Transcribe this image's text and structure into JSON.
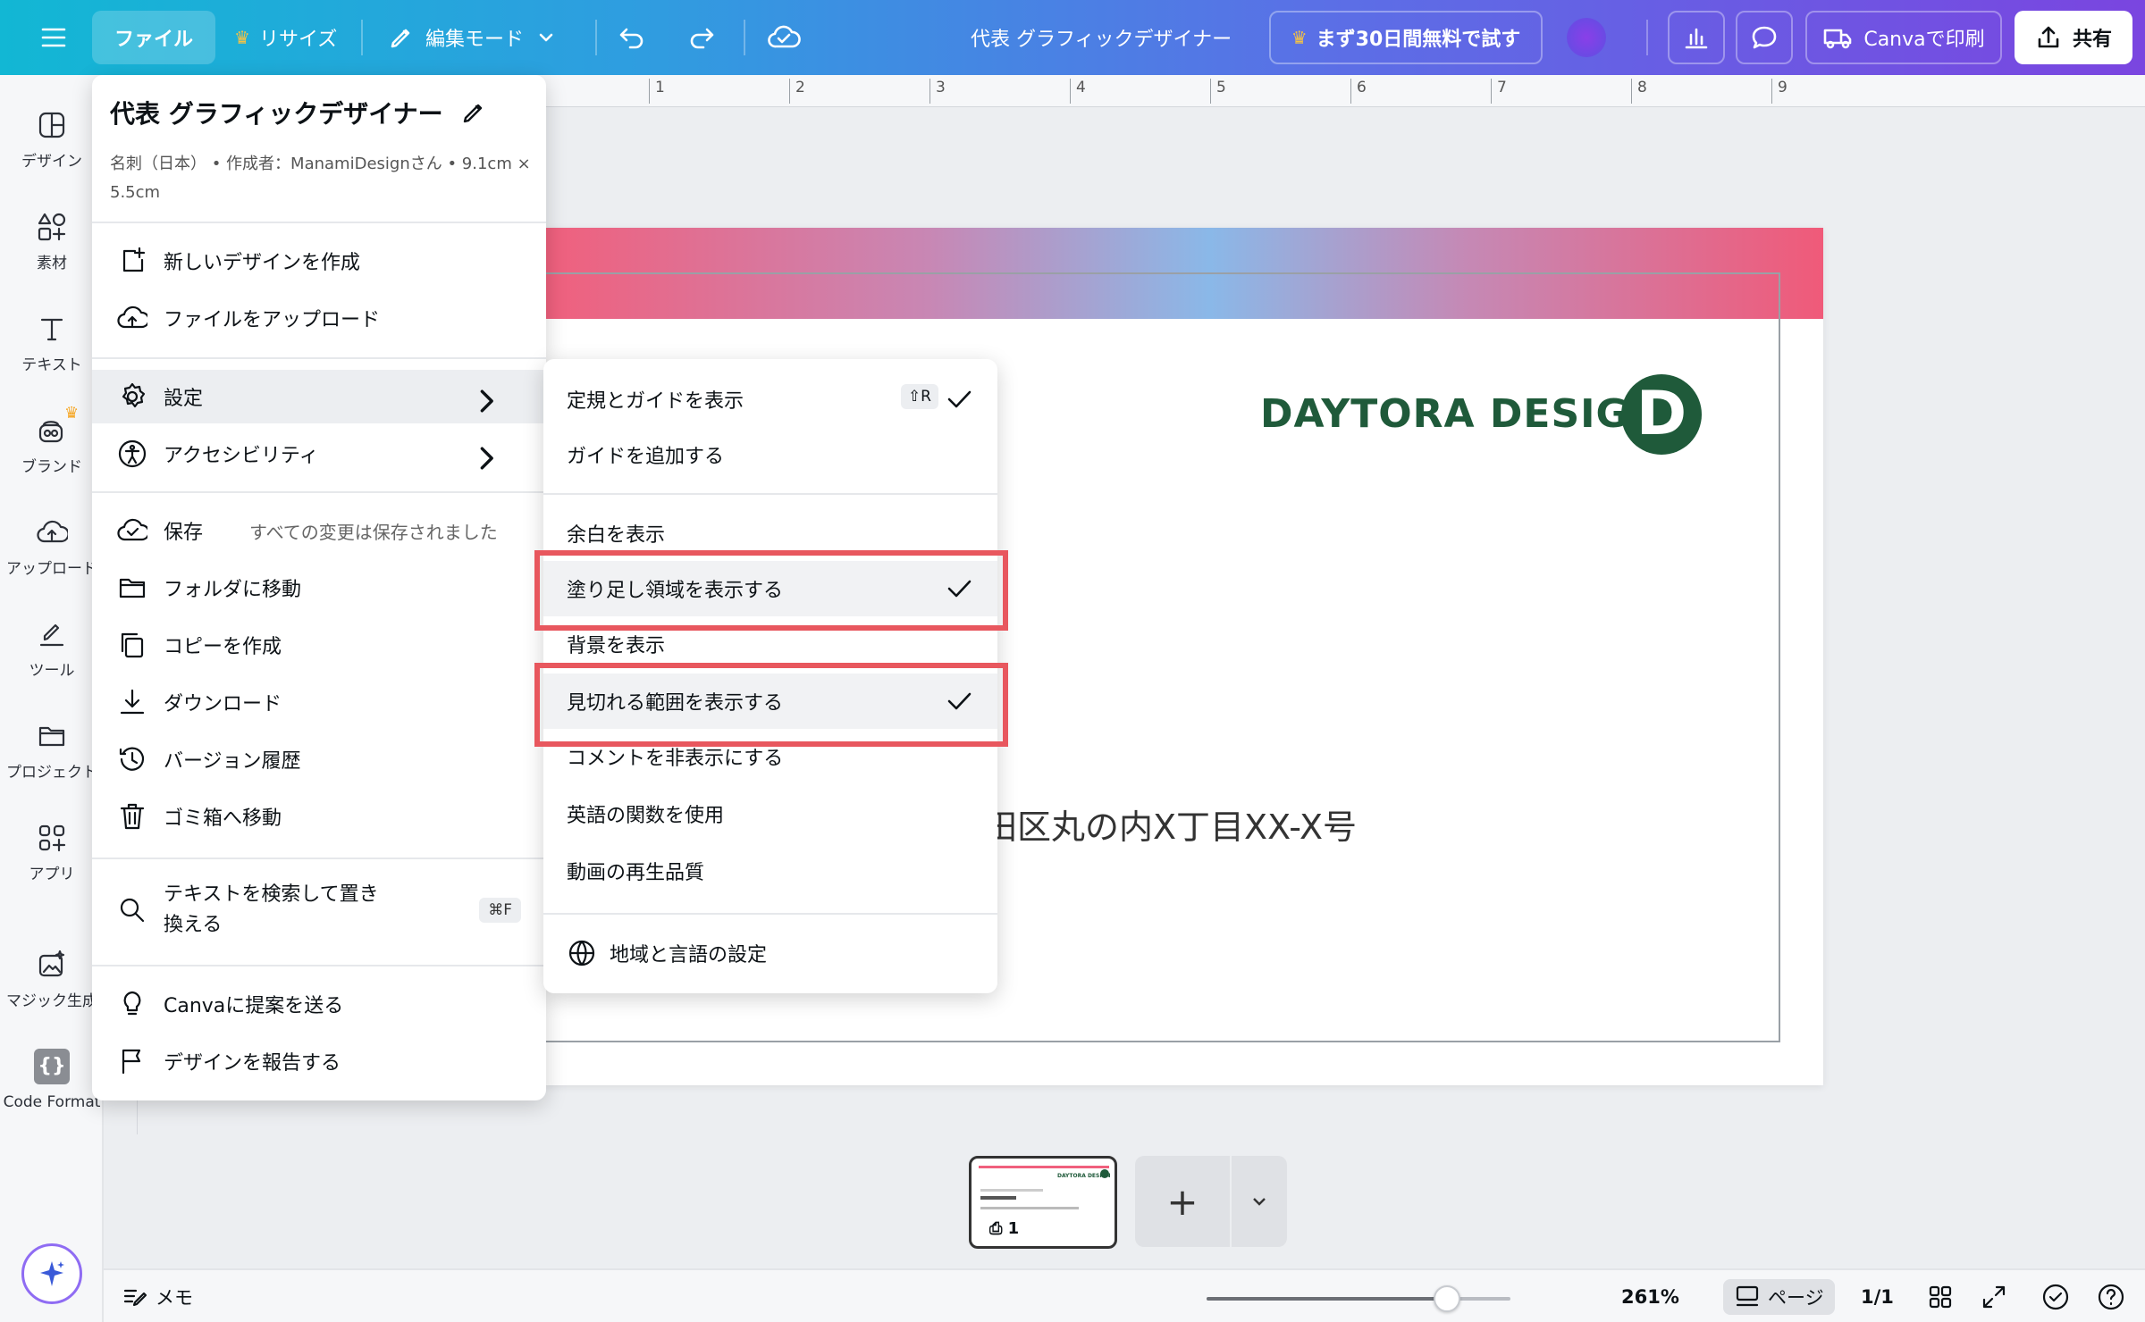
{
  "header": {
    "file_label": "ファイル",
    "resize_label": "リサイズ",
    "edit_mode_label": "編集モード",
    "design_title": "代表 グラフィックデザイナー",
    "trial_label": "まず30日間無料で試す",
    "print_label": "Canvaで印刷",
    "share_label": "共有"
  },
  "sidebar": {
    "items": [
      {
        "label": "デザイン",
        "icon": "layout-icon"
      },
      {
        "label": "素材",
        "icon": "shapes-icon"
      },
      {
        "label": "テキスト",
        "icon": "text-icon"
      },
      {
        "label": "ブランド",
        "icon": "brand-icon"
      },
      {
        "label": "アップロード",
        "icon": "cloud-upload-icon"
      },
      {
        "label": "ツール",
        "icon": "draw-icon"
      },
      {
        "label": "プロジェクト",
        "icon": "folder-icon"
      },
      {
        "label": "アプリ",
        "icon": "apps-icon"
      },
      {
        "label": "マジック生成",
        "icon": "magic-media-icon"
      },
      {
        "label": "Code Format",
        "icon": "code-icon"
      }
    ]
  },
  "ruler": {
    "ticks": [
      "1",
      "2",
      "3",
      "4",
      "5",
      "6",
      "7",
      "8",
      "9"
    ]
  },
  "canvas": {
    "logo_text": "DAYTORA DESIGN",
    "logo_letter": "D",
    "address_text": "田区丸の内X丁目XX-X号"
  },
  "file_menu": {
    "title": "代表 グラフィックデザイナー",
    "subtitle": "名刺（日本） • 作成者：ManamiDesignさん • 9.1cm × 5.5cm",
    "items": {
      "new_design": "新しいデザインを作成",
      "upload": "ファイルをアップロード",
      "settings": "設定",
      "accessibility": "アクセシビリティ",
      "save": "保存",
      "save_status": "すべての変更は保存されました",
      "move_folder": "フォルダに移動",
      "copy": "コピーを作成",
      "download": "ダウンロード",
      "version_history": "バージョン履歴",
      "trash": "ゴミ箱へ移動",
      "find_replace": "テキストを検索して置き換える",
      "find_replace_shortcut": "⌘F",
      "suggest": "Canvaに提案を送る",
      "report": "デザインを報告する"
    }
  },
  "settings_menu": {
    "items": [
      {
        "label": "定規とガイドを表示",
        "shortcut": "⇧R",
        "checked": true
      },
      {
        "label": "ガイドを追加する",
        "checked": false
      },
      {
        "label": "余白を表示",
        "checked": false
      },
      {
        "label": "塗り足し領域を表示する",
        "checked": true,
        "highlighted": true
      },
      {
        "label": "背景を表示",
        "checked": false
      },
      {
        "label": "見切れる範囲を表示する",
        "checked": true,
        "highlighted": true
      },
      {
        "label": "コメントを非表示にする",
        "checked": false
      },
      {
        "label": "英語の関数を使用",
        "checked": false
      },
      {
        "label": "動画の再生品質",
        "checked": false
      }
    ],
    "language_label": "地域と言語の設定"
  },
  "pages": {
    "thumb_number": "1"
  },
  "footer": {
    "notes_label": "メモ",
    "zoom": "261%",
    "zoom_level": 0.79,
    "page_label": "ページ",
    "page_count": "1/1"
  },
  "colors": {
    "highlight": "#e8575e",
    "logo_green": "#1f5a3a",
    "header_gradient_start": "#12b7d4",
    "header_gradient_end": "#7a45e0"
  }
}
